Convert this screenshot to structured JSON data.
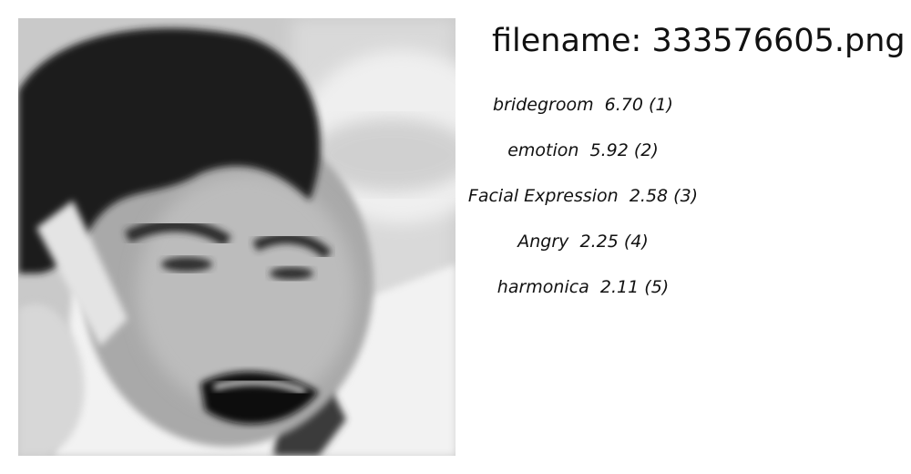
{
  "header": {
    "filename": "filename: 333576605.png"
  },
  "labels": [
    {
      "name": "bridegroom",
      "score": "6.70",
      "rank": "(1)"
    },
    {
      "name": "emotion",
      "score": "5.92",
      "rank": "(2)"
    },
    {
      "name": "Facial Expression",
      "score": "2.58",
      "rank": "(3)"
    },
    {
      "name": "Angry",
      "score": "2.25",
      "rank": "(4)"
    },
    {
      "name": "harmonica",
      "score": "2.11",
      "rank": "(5)"
    }
  ],
  "colors": {
    "text": "#111111",
    "photo_bg": "#cfcfcf",
    "background": "#ffffff"
  }
}
